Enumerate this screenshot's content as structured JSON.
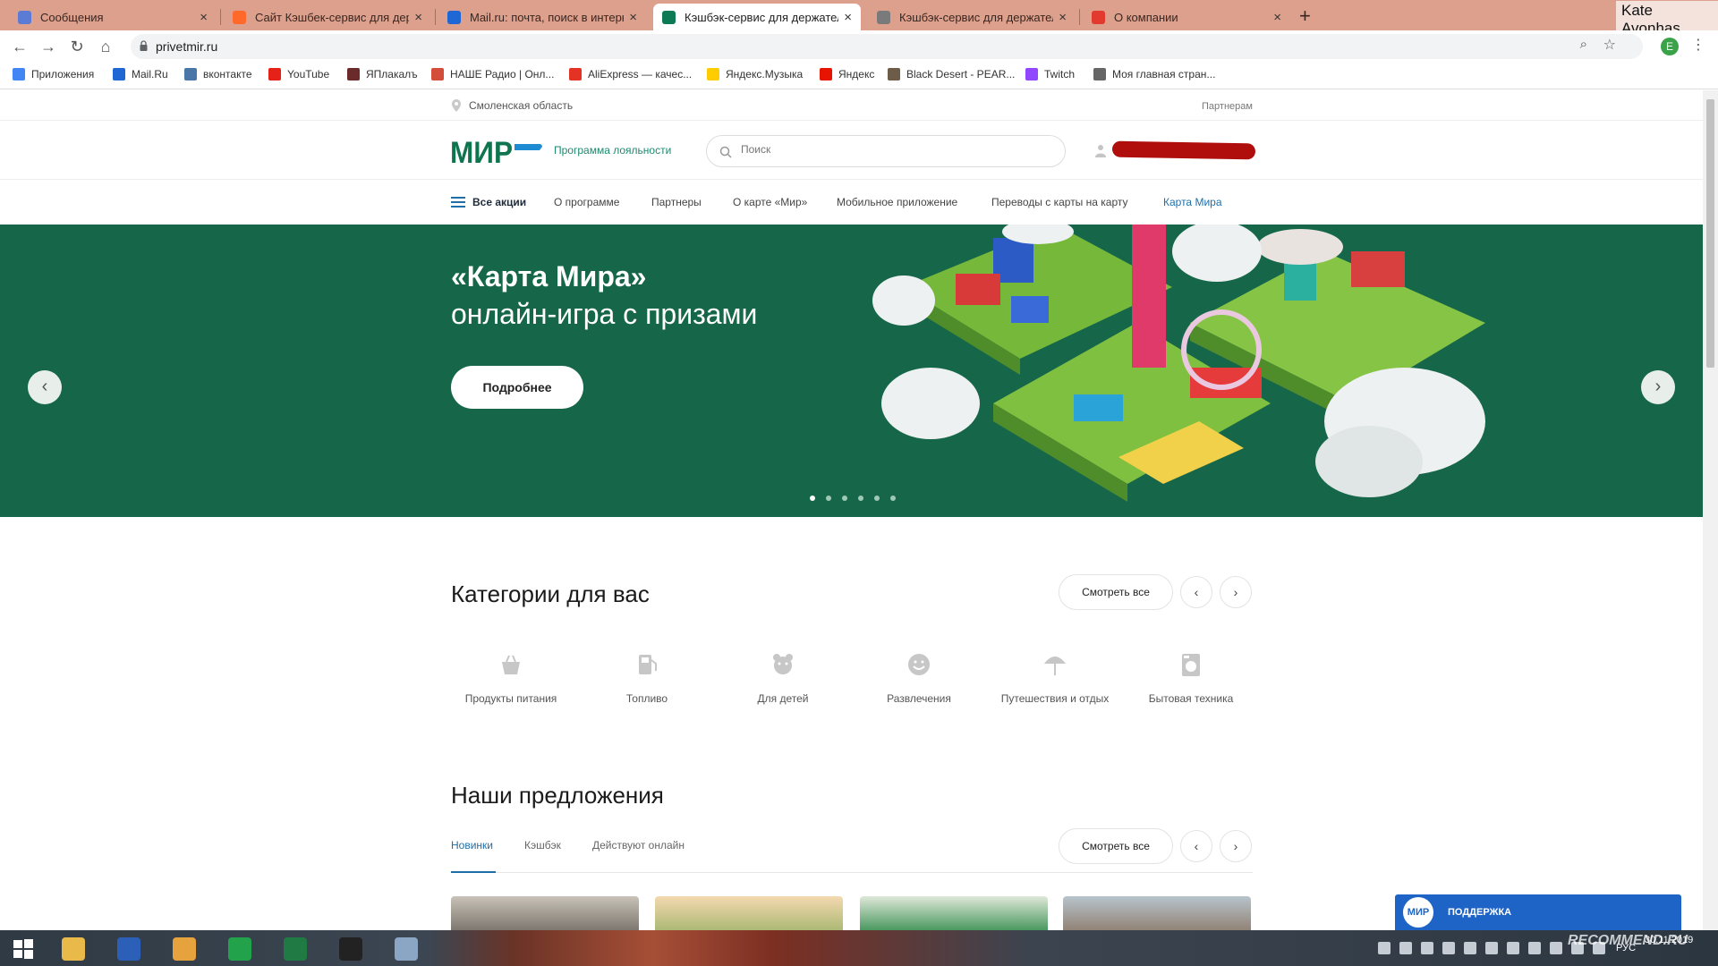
{
  "browser": {
    "tabs": [
      {
        "title": "Сообщения",
        "favicon_color": "#5b7bd5",
        "active": false
      },
      {
        "title": "Сайт Кэшбек-сервис для держа",
        "favicon_color": "#ff6a2b",
        "active": false
      },
      {
        "title": "Mail.ru: почта, поиск в интерне",
        "favicon_color": "#1f67d4",
        "active": false
      },
      {
        "title": "Кэшбэк-сервис для держателе",
        "favicon_color": "#0b7a55",
        "active": true
      },
      {
        "title": "Кэшбэк-сервис для держателе",
        "favicon_color": "#7a7a7a",
        "active": false
      },
      {
        "title": "О компании",
        "favicon_color": "#e23a2e",
        "active": false
      }
    ],
    "tab_close_glyph": "×",
    "new_tab_glyph": "+",
    "profile_name": "Kate Avonhas",
    "url": "privetmir.ru",
    "profile_initial": "E",
    "bookmarks": [
      {
        "label": "Приложения",
        "icon": "apps-grid-icon",
        "color": "#4285f4"
      },
      {
        "label": "Mail.Ru",
        "icon": "mailru-icon",
        "color": "#1f67d4"
      },
      {
        "label": "вконтакте",
        "icon": "vk-icon",
        "color": "#4a76a8"
      },
      {
        "label": "YouTube",
        "icon": "youtube-icon",
        "color": "#e62117"
      },
      {
        "label": "ЯПлакалъ",
        "icon": "yaplakal-icon",
        "color": "#6b2b2b"
      },
      {
        "label": "НАШЕ Радио | Онл...",
        "icon": "nashe-radio-icon",
        "color": "#d44c3a"
      },
      {
        "label": "AliExpress — качес...",
        "icon": "aliexpress-icon",
        "color": "#e43225"
      },
      {
        "label": "Яндекс.Музыка",
        "icon": "yandex-music-icon",
        "color": "#ffcc00"
      },
      {
        "label": "Яндекс",
        "icon": "yandex-icon",
        "color": "#e61400"
      },
      {
        "label": "Black Desert - PEAR...",
        "icon": "black-desert-icon",
        "color": "#6d5d48"
      },
      {
        "label": "Twitch",
        "icon": "twitch-icon",
        "color": "#9146ff"
      },
      {
        "label": "Моя главная стран...",
        "icon": "my-page-icon",
        "color": "#666666"
      }
    ]
  },
  "site": {
    "region": "Смоленская область",
    "partners_link": "Партнерам",
    "logo_text": "МИР",
    "loyalty_text": "Программа лояльности",
    "search_placeholder": "Поиск",
    "nav": [
      "Все акции",
      "О программе",
      "Партнеры",
      "О карте «Мир»",
      "Мобильное приложение",
      "Переводы с карты на карту",
      "Карта Мира"
    ],
    "hero": {
      "title": "«Карта Мира»",
      "subtitle": "онлайн-игра с призами",
      "button": "Подробнее",
      "slide_count": 6,
      "active_slide": 1
    },
    "categories": {
      "title": "Категории для вас",
      "see_all": "Смотреть все",
      "items": [
        {
          "label": "Продукты питания",
          "icon": "basket-icon"
        },
        {
          "label": "Топливо",
          "icon": "fuel-icon"
        },
        {
          "label": "Для детей",
          "icon": "teddy-bear-icon"
        },
        {
          "label": "Развлечения",
          "icon": "smile-icon"
        },
        {
          "label": "Путешествия и отдых",
          "icon": "umbrella-icon"
        },
        {
          "label": "Бытовая техника",
          "icon": "washing-machine-icon"
        }
      ]
    },
    "offers": {
      "title": "Наши предложения",
      "see_all": "Смотреть все",
      "tabs": [
        "Новинки",
        "Кэшбэк",
        "Действуют онлайн"
      ],
      "active_tab": 0
    },
    "support": {
      "logo": "МИР",
      "label": "ПОДДЕРЖКА"
    }
  },
  "taskbar": {
    "apps": [
      "start-button",
      "file-explorer-icon",
      "save-icon",
      "chrome-icon",
      "green-app-icon",
      "excel-icon",
      "game-icon",
      "calculator-icon"
    ],
    "lang": "РУС",
    "time": "—",
    "date": "30.11.2019",
    "watermark": "RECOMMEND.RU"
  }
}
